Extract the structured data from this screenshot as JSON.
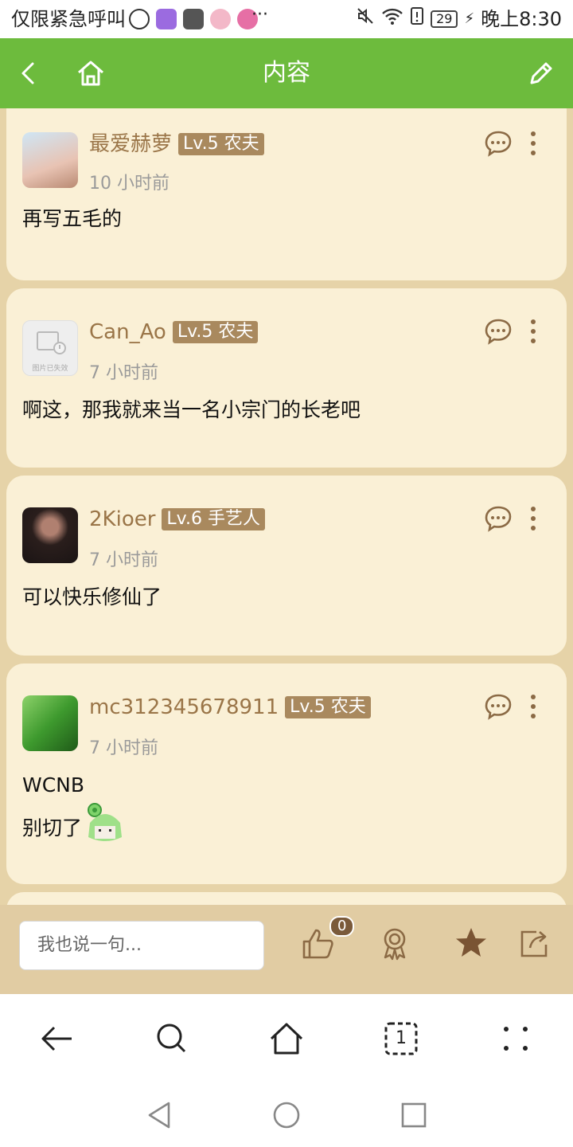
{
  "status_bar": {
    "left_text": "仅限紧急呼叫",
    "battery": "29",
    "time": "晚上8:30"
  },
  "header": {
    "title": "内容"
  },
  "comments": [
    {
      "username": "最爱赫萝",
      "level": "Lv.5 农夫",
      "time": "10 小时前",
      "lines": [
        "再写五毛的"
      ],
      "avatar_color": "#d7b8a8"
    },
    {
      "username": "Can_Ao",
      "level": "Lv.5 农夫",
      "time": "7 小时前",
      "lines": [
        "啊这，那我就来当一名小宗门的长老吧"
      ],
      "avatar_text": "图片已失效",
      "avatar_color": "#eeeeee"
    },
    {
      "username": "2Kioer",
      "level": "Lv.6 手艺人",
      "time": "7 小时前",
      "lines": [
        "可以快乐修仙了"
      ],
      "avatar_color": "#3a2a28"
    },
    {
      "username": "mc312345678911",
      "level": "Lv.5 农夫",
      "time": "7 小时前",
      "lines": [
        "WCNB",
        "别切了"
      ],
      "avatar_color": "#4fa63a"
    }
  ],
  "reply_bar": {
    "placeholder": "我也说一句...",
    "like_count": "0"
  },
  "browser_nav": {
    "tab_count": "1"
  },
  "colors": {
    "header_green": "#6dbb3d",
    "card_bg": "#faf0d6",
    "list_bg": "#e6d3a8",
    "name_brown": "#9a7548",
    "badge_bg": "#a9895e"
  }
}
